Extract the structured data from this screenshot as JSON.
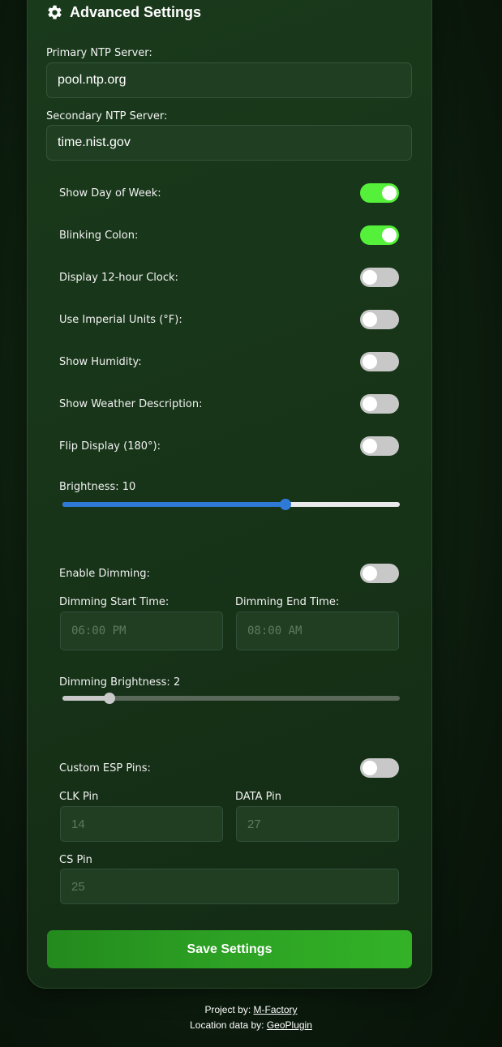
{
  "header": {
    "title": "Advanced Settings",
    "icon": "gear-icon"
  },
  "ntp": {
    "primary_label": "Primary NTP Server:",
    "primary_value": "pool.ntp.org",
    "secondary_label": "Secondary NTP Server:",
    "secondary_value": "time.nist.gov"
  },
  "toggles": [
    {
      "label": "Show Day of Week:",
      "on": true
    },
    {
      "label": "Blinking Colon:",
      "on": true
    },
    {
      "label": "Display 12-hour Clock:",
      "on": false
    },
    {
      "label": "Use Imperial Units (°F):",
      "on": false
    },
    {
      "label": "Show Humidity:",
      "on": false
    },
    {
      "label": "Show Weather Description:",
      "on": false
    },
    {
      "label": "Flip Display (180°):",
      "on": false
    }
  ],
  "brightness": {
    "label": "Brightness: 10",
    "fraction": 0.66,
    "color": "#2f7ad6"
  },
  "dimming": {
    "enable_label": "Enable Dimming:",
    "enabled": false,
    "start_label": "Dimming Start Time:",
    "start_value": "06:00 PM",
    "end_label": "Dimming End Time:",
    "end_value": "08:00 AM",
    "brightness_label": "Dimming Brightness: 2",
    "brightness_fraction": 0.14
  },
  "pins": {
    "custom_label": "Custom ESP Pins:",
    "enabled": false,
    "clk_label": "CLK Pin",
    "clk_value": "14",
    "data_label": "DATA Pin",
    "data_value": "27",
    "cs_label": "CS Pin",
    "cs_value": "25"
  },
  "save_label": "Save Settings",
  "footer": {
    "project_prefix": "Project by:",
    "project_link": "M-Factory",
    "location_prefix": "Location data by:",
    "location_link": "GeoPlugin"
  },
  "colors": {
    "toggle_on": "#55f03a",
    "toggle_off": "#c8c8c8",
    "save_button": "#2da224"
  }
}
